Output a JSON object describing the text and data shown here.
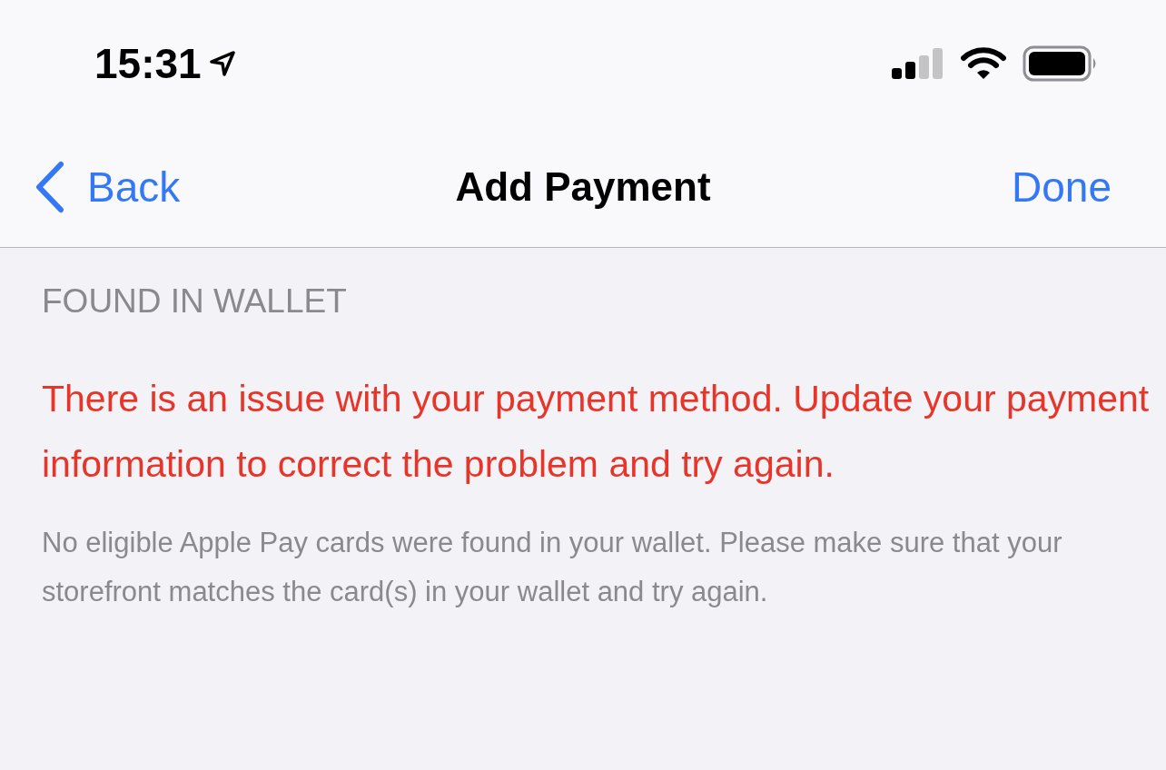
{
  "status_bar": {
    "time": "15:31"
  },
  "nav_bar": {
    "back": "Back",
    "title": "Add Payment",
    "done": "Done"
  },
  "section": {
    "header": "FOUND IN WALLET",
    "error": "There is an issue with your payment method. Update your payment information to correct the problem and try again.",
    "footer": "No eligible Apple Pay cards were found in your wallet. Please make sure that your storefront matches the card(s) in your wallet and try again."
  }
}
